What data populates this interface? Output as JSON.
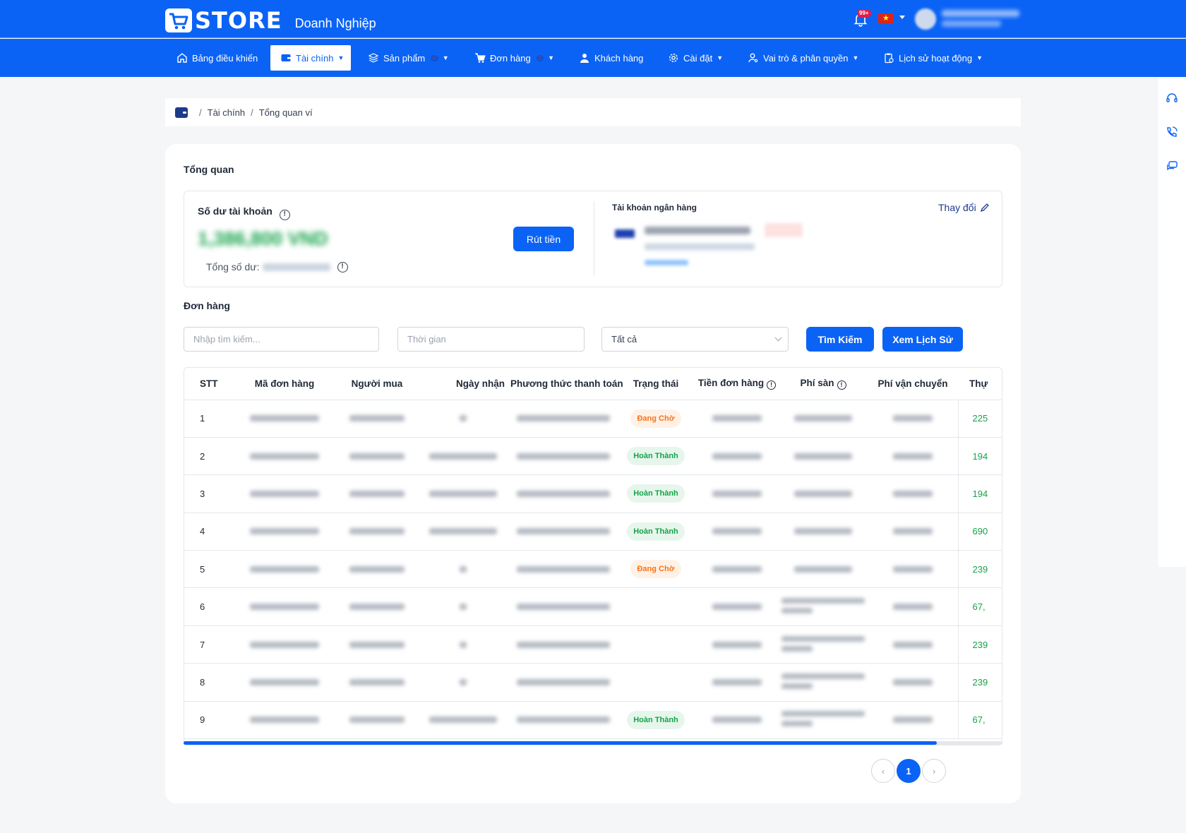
{
  "header": {
    "logo_text": "STORE",
    "logo_subtitle": "Doanh Nghiệp",
    "notification_badge": "99+"
  },
  "nav": {
    "items": [
      {
        "label": "Bảng điều khiển",
        "icon": "home-icon",
        "active": false,
        "has_dropdown": false
      },
      {
        "label": "Tài chính",
        "icon": "wallet-icon",
        "active": true,
        "has_dropdown": true
      },
      {
        "label": "Sản phẩm",
        "icon": "layers-icon",
        "active": false,
        "has_dropdown": true,
        "badge": "0"
      },
      {
        "label": "Đơn hàng",
        "icon": "cart-icon",
        "active": false,
        "has_dropdown": true,
        "badge": "0"
      },
      {
        "label": "Khách hàng",
        "icon": "user-icon",
        "active": false,
        "has_dropdown": false
      },
      {
        "label": "Cài đặt",
        "icon": "gear-icon",
        "active": false,
        "has_dropdown": true
      },
      {
        "label": "Vai trò & phân quyền",
        "icon": "user-key-icon",
        "active": false,
        "has_dropdown": true
      },
      {
        "label": "Lịch sử hoạt động",
        "icon": "clipboard-icon",
        "active": false,
        "has_dropdown": true
      }
    ]
  },
  "breadcrumb": {
    "items": [
      "Tài chính",
      "Tổng quan ví"
    ],
    "separator": "/"
  },
  "overview": {
    "title": "Tổng quan",
    "balance_label": "Số dư tài khoản",
    "balance_value": "1,386,800 VND",
    "total_label": "Tổng số dư:",
    "withdraw_button": "Rút tiền",
    "bank_label": "Tài khoản ngân hàng",
    "bank_change": "Thay đổi",
    "bank_name": "ACB - NH TMCP A Chau"
  },
  "orders": {
    "title": "Đơn hàng",
    "search_placeholder": "Nhập tìm kiếm...",
    "time_placeholder": "Thời gian",
    "status_select": "Tất cả",
    "search_button": "Tìm Kiếm",
    "history_button": "Xem Lịch Sử",
    "columns": [
      "STT",
      "Mã đơn hàng",
      "Người mua",
      "Ngày nhận",
      "Phương thức thanh toán",
      "Trạng thái",
      "Tiền đơn hàng",
      "Phí sàn",
      "Phí vận chuyển",
      "Thự"
    ],
    "rows": [
      {
        "stt": "1",
        "status": "Đang Chờ",
        "status_type": "wait",
        "last": "225",
        "date_dash": true,
        "fee_two_lines": false
      },
      {
        "stt": "2",
        "status": "Hoàn Thành",
        "status_type": "done",
        "last": "194",
        "date_dash": false,
        "fee_two_lines": false
      },
      {
        "stt": "3",
        "status": "Hoàn Thành",
        "status_type": "done",
        "last": "194",
        "date_dash": false,
        "fee_two_lines": false
      },
      {
        "stt": "4",
        "status": "Hoàn Thành",
        "status_type": "done",
        "last": "690",
        "date_dash": false,
        "fee_two_lines": false
      },
      {
        "stt": "5",
        "status": "Đang Chờ",
        "status_type": "wait",
        "last": "239",
        "date_dash": true,
        "fee_two_lines": false
      },
      {
        "stt": "6",
        "status": "",
        "status_type": "",
        "last": "67,",
        "date_dash": true,
        "fee_two_lines": true
      },
      {
        "stt": "7",
        "status": "",
        "status_type": "",
        "last": "239",
        "date_dash": true,
        "fee_two_lines": true
      },
      {
        "stt": "8",
        "status": "",
        "status_type": "",
        "last": "239",
        "date_dash": true,
        "fee_two_lines": true
      },
      {
        "stt": "9",
        "status": "Hoàn Thành",
        "status_type": "done",
        "last": "67,",
        "date_dash": false,
        "fee_two_lines": true
      }
    ],
    "table_scroll_fraction": 0.92
  },
  "pagination": {
    "prev": "‹",
    "current": "1",
    "next": "›"
  },
  "colors": {
    "primary": "#0b63f6",
    "success": "#16a34a",
    "warning": "#f97316"
  }
}
